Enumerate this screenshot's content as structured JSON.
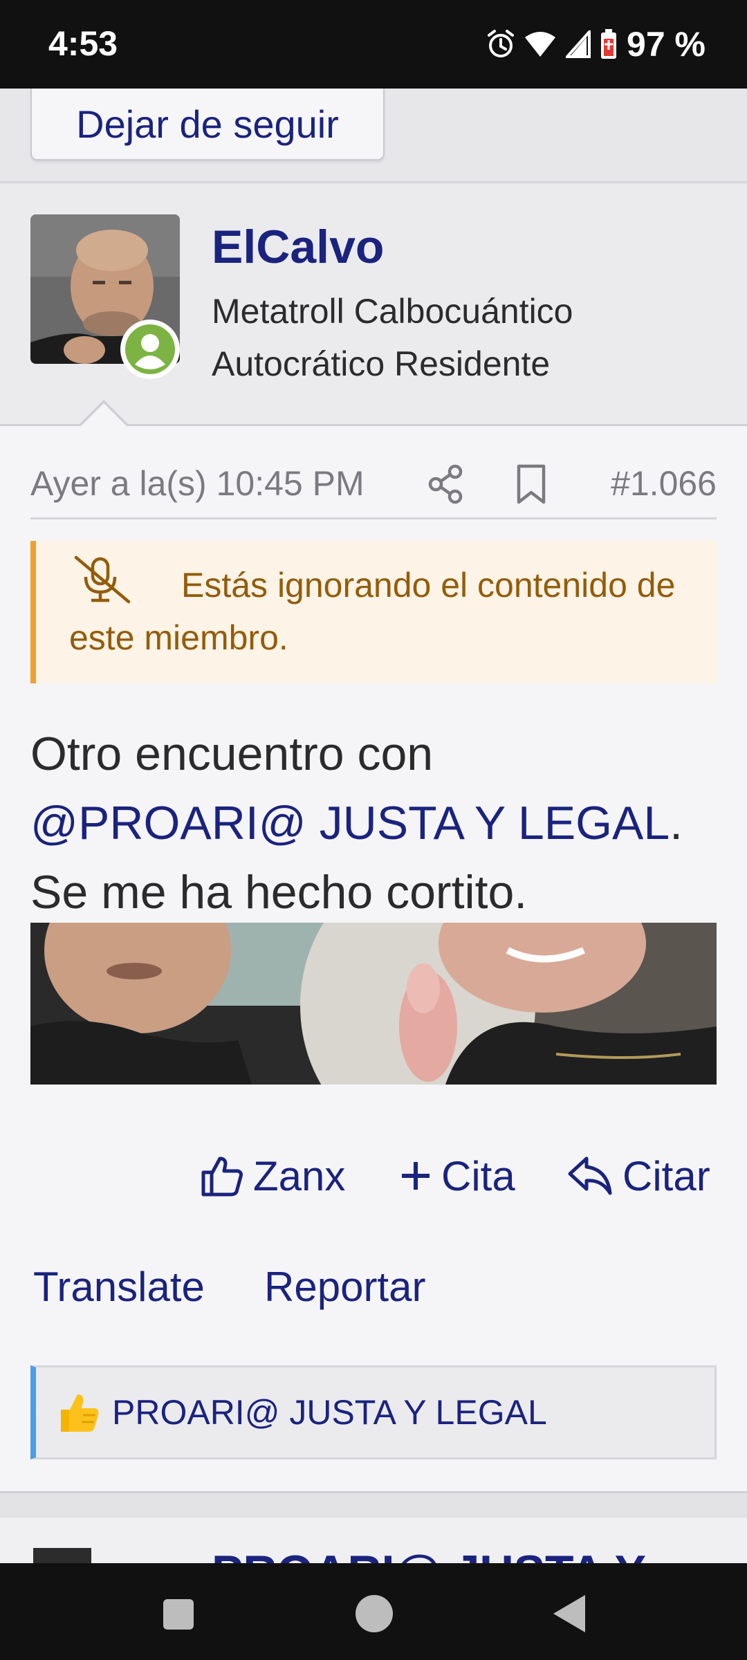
{
  "status_bar": {
    "time": "4:53",
    "battery": "97 %"
  },
  "follow": {
    "unfollow_label": "Dejar de seguir"
  },
  "user": {
    "name": "ElCalvo",
    "title": "Metatroll Calbocuántico Autocrático Residente"
  },
  "post": {
    "date": "Ayer a la(s) 10:45 PM",
    "number": "#1.066",
    "ignored_notice": "Estás ignorando el contenido de este miembro.",
    "body_prefix": "Otro encuentro con",
    "mention": "@PROARI@ JUSTA Y LEGAL",
    "body_after_mention": ".",
    "body_line_3": "Se me ha hecho cortito."
  },
  "actions": {
    "like": "Zanx",
    "multiquote": "Cita",
    "quote": "Citar"
  },
  "links": {
    "translate": "Translate",
    "report": "Reportar"
  },
  "reactions": {
    "users": "PROARI@ JUSTA Y LEGAL"
  },
  "next_post": {
    "name_partial": "PROARI@ JUSTA Y"
  },
  "colors": {
    "link": "#1a237e",
    "notice_bg": "#fdf3e6",
    "notice_accent": "#f0a030",
    "online": "#7cb342",
    "reaction_accent": "#4a9de8"
  },
  "icons": [
    "alarm-icon",
    "wifi-icon",
    "signal-icon",
    "battery-icon",
    "share-icon",
    "bookmark-icon",
    "mic-off-icon",
    "thumbs-up-icon",
    "plus-icon",
    "reply-icon",
    "thumbs-up-emoji",
    "nav-recents-icon",
    "nav-home-icon",
    "nav-back-icon"
  ]
}
